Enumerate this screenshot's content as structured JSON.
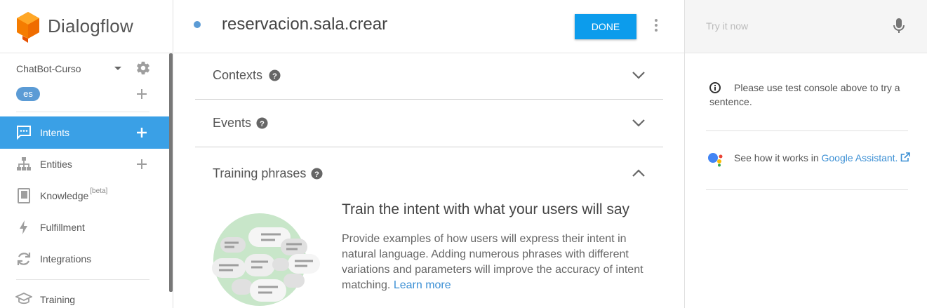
{
  "app": {
    "name": "Dialogflow"
  },
  "sidebar": {
    "agent_name": "ChatBot-Curso",
    "language": "es",
    "items": [
      {
        "label": "Intents",
        "icon": "chat-bubble-icon",
        "active": true,
        "has_add": true
      },
      {
        "label": "Entities",
        "icon": "sitemap-icon",
        "active": false,
        "has_add": true
      },
      {
        "label": "Knowledge",
        "badge": "[beta]",
        "icon": "book-icon",
        "active": false,
        "has_add": false
      },
      {
        "label": "Fulfillment",
        "icon": "bolt-icon",
        "active": false,
        "has_add": false
      },
      {
        "label": "Integrations",
        "icon": "sync-icon",
        "active": false,
        "has_add": false
      },
      {
        "label": "Training",
        "icon": "graduation-cap-icon",
        "active": false,
        "has_add": false
      }
    ]
  },
  "intent": {
    "name": "reservacion.sala.crear",
    "done_label": "DONE"
  },
  "sections": {
    "contexts": "Contexts",
    "events": "Events",
    "training": "Training phrases"
  },
  "training": {
    "title": "Train the intent with what your users will say",
    "description": "Provide examples of how users will express their intent in natural language. Adding numerous phrases with different variations and parameters will improve the accuracy of intent matching.",
    "learn_more": "Learn more"
  },
  "console": {
    "placeholder": "Try it now",
    "info": "Please use test console above to try a sentence.",
    "assistant_prefix": "See how it works in ",
    "assistant_link": "Google Assistant."
  },
  "colors": {
    "accent": "#3aa0e6",
    "done_button": "#0c9cec",
    "logo_orange": "#f57c00",
    "link": "#3b8fd4"
  }
}
